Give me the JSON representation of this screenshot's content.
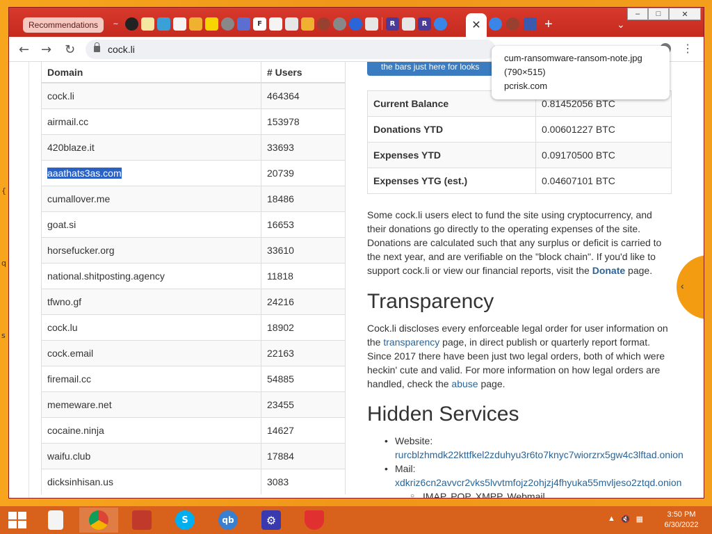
{
  "browser": {
    "recommendations_tab": "Recommendations",
    "tab_glyphs": [
      "R",
      "R",
      "R"
    ],
    "new_tab": "+",
    "tab_list": "⌄",
    "close_tab": "✕",
    "window_controls": {
      "minimize": "–",
      "maximize": "□",
      "close": "✕"
    },
    "address": "cock.li",
    "nav": {
      "back": "←",
      "forward": "→",
      "reload": "↻"
    },
    "menu": "⋮"
  },
  "tooltip": {
    "title": "cum-ransomware-ransom-note.jpg",
    "dimensions": "(790×515)",
    "site": "pcrisk.com"
  },
  "domains_table": {
    "headers": [
      "Domain",
      "# Users"
    ],
    "rows": [
      [
        "cock.li",
        "464364"
      ],
      [
        "airmail.cc",
        "153978"
      ],
      [
        "420blaze.it",
        "33693"
      ],
      [
        "aaathats3as.com",
        "20739"
      ],
      [
        "cumallover.me",
        "18486"
      ],
      [
        "goat.si",
        "16653"
      ],
      [
        "horsefucker.org",
        "33610"
      ],
      [
        "national.shitposting.agency",
        "11818"
      ],
      [
        "tfwno.gf",
        "24216"
      ],
      [
        "cock.lu",
        "18902"
      ],
      [
        "cock.email",
        "22163"
      ],
      [
        "firemail.cc",
        "54885"
      ],
      [
        "memeware.net",
        "23455"
      ],
      [
        "cocaine.ninja",
        "14627"
      ],
      [
        "waifu.club",
        "17884"
      ],
      [
        "dicksinhisan.us",
        "3083"
      ]
    ],
    "selected_row": 3
  },
  "donate_banner": "the bars just here for looks",
  "balance_table": [
    [
      "Current Balance",
      "0.81452056 BTC"
    ],
    [
      "Donations YTD",
      "0.00601227 BTC"
    ],
    [
      "Expenses YTD",
      "0.09170500 BTC"
    ],
    [
      "Expenses YTG (est.)",
      "0.04607101 BTC"
    ]
  ],
  "donation_para": {
    "text": "Some cock.li users elect to fund the site using cryptocurrency, and their donations go directly to the operating expenses of the site. Donations are calculated such that any surplus or deficit is carried to the next year, and are verifiable on the \"block chain\". If you'd like to support cock.li or view our financial reports, visit the ",
    "link": "Donate",
    "after": " page."
  },
  "transparency": {
    "heading": "Transparency",
    "before": "Cock.li discloses every enforceable legal order for user information on the ",
    "link1": "transparency",
    "middle": " page, in direct publish or quarterly report format. Since 2017 there have been just two legal orders, both of which were heckin' cute and valid. For more information on how legal orders are handled, check the ",
    "link2": "abuse",
    "after": " page."
  },
  "hidden_services": {
    "heading": "Hidden Services",
    "website_label": "Website:",
    "website_onion": "rurcblzhmdk22kttfkel2zduhyu3r6to7knyc7wiorzrx5gw4c3lftad.onion",
    "mail_label": "Mail:",
    "mail_onion": "xdkriz6cn2avvcr2vks5lvvtmfojz2ohjzj4fhyuka55mvljeso2ztqd.onion",
    "protocols": "IMAP, POP, XMPP, Webmail"
  },
  "side_tab_arrow": "‹",
  "taskbar": {
    "time": "3:50 PM",
    "date": "6/30/2022",
    "apps": [
      "file-explorer",
      "chrome",
      "pdf-app",
      "skype",
      "qbittorrent",
      "settings",
      "shield-app"
    ],
    "qb_label": "qb",
    "skype_label": "S"
  },
  "colors": {
    "tabstrip": "#c52a1f",
    "taskbar": "#d8611b",
    "link": "#2a6496",
    "selection": "#2962c4",
    "side_tab": "#f39c12"
  }
}
